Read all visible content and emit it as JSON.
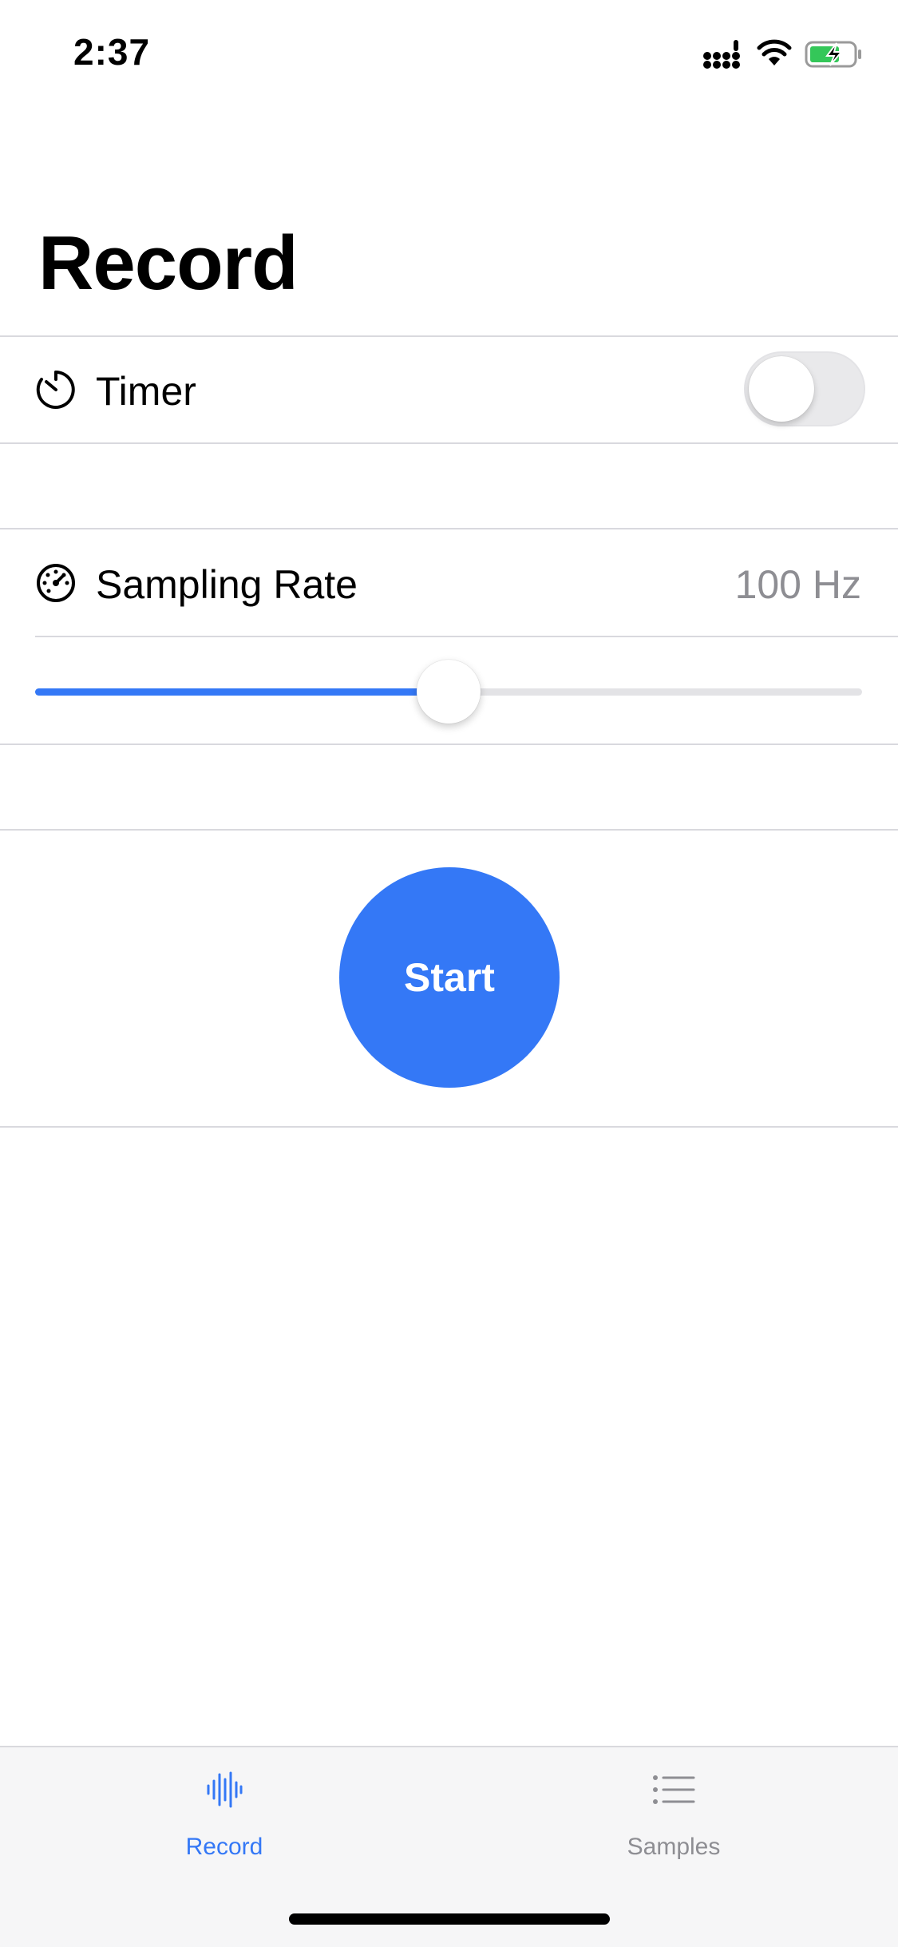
{
  "status_bar": {
    "time": "2:37",
    "icons": [
      "signal-icon",
      "wifi-icon",
      "battery-charging-icon"
    ]
  },
  "page": {
    "title": "Record"
  },
  "settings": {
    "timer": {
      "label": "Timer",
      "icon": "timer-icon",
      "enabled": false
    },
    "sampling_rate": {
      "label": "Sampling Rate",
      "icon": "gauge-icon",
      "value_text": "100 Hz",
      "slider_fraction": 0.5
    }
  },
  "actions": {
    "start_label": "Start"
  },
  "colors": {
    "accent": "#3478f6",
    "secondary_text": "#8e8e93",
    "separator": "#d9d9de",
    "tab_bar_bg": "#f6f6f7"
  },
  "tab_bar": {
    "tabs": [
      {
        "label": "Record",
        "icon": "waveform-icon",
        "selected": true
      },
      {
        "label": "Samples",
        "icon": "list-icon",
        "selected": false
      }
    ]
  }
}
